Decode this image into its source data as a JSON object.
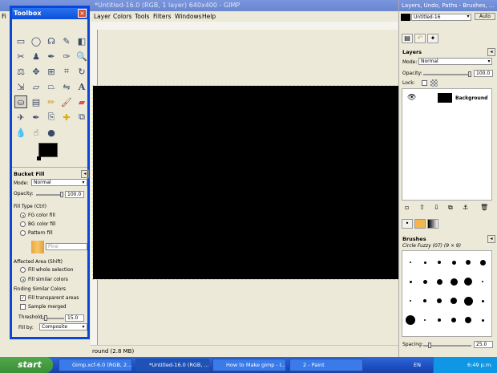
{
  "image_window": {
    "title": "*Untitled-16.0 (RGB, 1 layer) 640x400 - GIMP",
    "menus": [
      "Fi",
      "Layer",
      "Colors",
      "Tools",
      "Filters",
      "Windows",
      "Help"
    ],
    "status": "round (2.8 MB)"
  },
  "toolbox": {
    "title": "Toolbox",
    "tool_options_title": "Bucket Fill",
    "mode_label": "Mode:",
    "mode_value": "Normal",
    "opacity_label": "Opacity:",
    "opacity_value": "100.0",
    "fill_type_label": "Fill Type  (Ctrl)",
    "fill_options": [
      "FG color fill",
      "BG color fill",
      "Pattern fill"
    ],
    "pattern_name": "Pine",
    "affected_area_label": "Affected Area  (Shift)",
    "affected_options": [
      "Fill whole selection",
      "Fill similar colors"
    ],
    "finding_label": "Finding Similar Colors",
    "fill_transparent_label": "Fill transparent areas",
    "sample_merged_label": "Sample merged",
    "threshold_label": "Threshold:",
    "threshold_value": "15.0",
    "fill_by_label": "Fill by:",
    "fill_by_value": "Composite"
  },
  "dock": {
    "title": "Layers, Undo, Paths - Brushes, ...",
    "image_selector": "Untitled-16",
    "auto_label": "Auto",
    "layers": {
      "title": "Layers",
      "mode_label": "Mode:",
      "mode_value": "Normal",
      "opacity_label": "Opacity:",
      "opacity_value": "100.0",
      "lock_label": "Lock:",
      "layer_name": "Background"
    },
    "brushes": {
      "title": "Brushes",
      "current_brush": "Circle Fuzzy (07) (9 × 9)",
      "spacing_label": "Spacing:",
      "spacing_value": "25.0"
    }
  },
  "taskbar": {
    "start_label": "start",
    "tasks": [
      "Gimp.xcf-6.0 (RGB, 2...",
      "*Untitled-16.0 (RGB, ...",
      "How to Make gimp - I...",
      "2 - Paint"
    ],
    "language": "EN",
    "clock": "6:49 p.m."
  },
  "colors": {
    "xp_blue": "#0a46d8",
    "canvas": "#000000",
    "panel": "#ece9d8"
  }
}
